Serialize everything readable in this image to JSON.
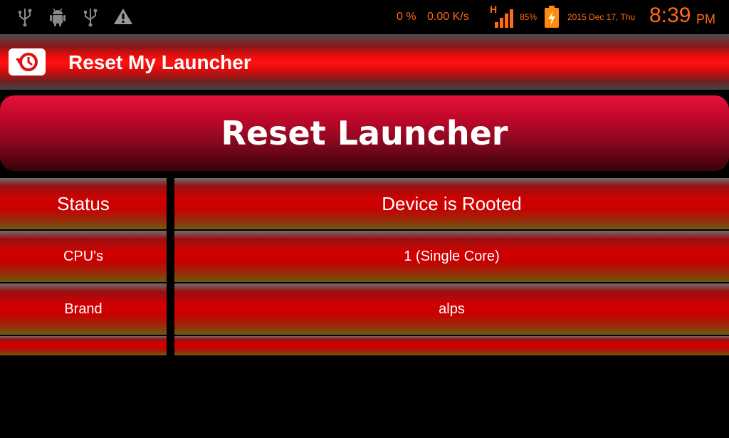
{
  "status_bar": {
    "icons": [
      "usb-icon",
      "android-debug-icon",
      "usb-icon",
      "warning-icon",
      "signal-h-icon",
      "battery-charging-icon"
    ],
    "cpu_percent": "0 %",
    "net_speed": "0.00 K/s",
    "network_type": "H",
    "battery": "85%",
    "date": "2015 Dec 17, Thu",
    "time": "8:39",
    "ampm": "PM",
    "accent_color": "#ff6a14"
  },
  "action_bar": {
    "title": "Reset My Launcher",
    "icon": "reset-launcher-app-icon"
  },
  "reset_button": {
    "label": "Reset Launcher"
  },
  "info_table": {
    "rows": [
      {
        "label": "Status",
        "value": "Device is Rooted"
      },
      {
        "label": "CPU's",
        "value": "1 (Single Core)"
      },
      {
        "label": "Brand",
        "value": "alps"
      }
    ]
  }
}
